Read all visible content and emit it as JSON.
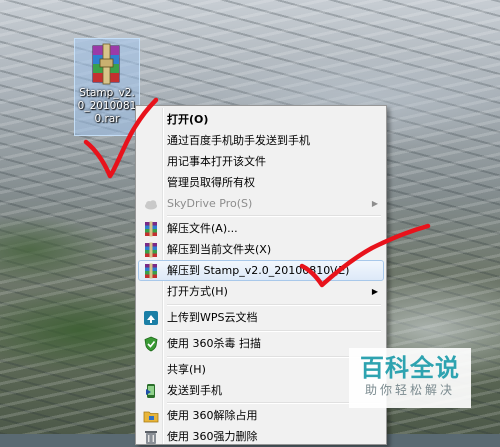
{
  "desktop": {
    "file_icon": "winrar-archive-icon",
    "file_name": "Stamp_v2.0_20100810.rar"
  },
  "context_menu": {
    "items": [
      {
        "label": "打开(O)",
        "bold": true
      },
      {
        "label": "通过百度手机助手发送到手机"
      },
      {
        "label": "用记事本打开该文件"
      },
      {
        "label": "管理员取得所有权"
      },
      {
        "label": "SkyDrive Pro(S)",
        "icon": "skydrive-cloud-icon",
        "disabled": true,
        "submenu": true
      },
      {
        "label": "解压文件(A)...",
        "icon": "winrar-icon"
      },
      {
        "label": "解压到当前文件夹(X)",
        "icon": "winrar-icon"
      },
      {
        "label": "解压到 Stamp_v2.0_20100810\\(E)",
        "icon": "winrar-icon",
        "highlighted": true
      },
      {
        "label": "打开方式(H)",
        "submenu": true
      },
      {
        "label": "上传到WPS云文档",
        "icon": "wps-cloud-icon"
      },
      {
        "label": "使用 360杀毒 扫描",
        "icon": "360-antivirus-shield-icon"
      },
      {
        "label": "共享(H)"
      },
      {
        "label": "发送到手机",
        "icon": "send-to-phone-icon"
      },
      {
        "label": "使用 360解除占用",
        "icon": "360-unlock-folder-icon"
      },
      {
        "label": "使用 360强力删除",
        "icon": "360-force-delete-icon"
      }
    ]
  },
  "watermark": {
    "title": "百科全说",
    "subtitle": "助你轻松解决"
  },
  "colors": {
    "menu_background": "#f1f1f1",
    "highlight_border": "#a8c8ea",
    "annotation_red": "#e8121b",
    "watermark_teal": "#2ea3b0"
  }
}
